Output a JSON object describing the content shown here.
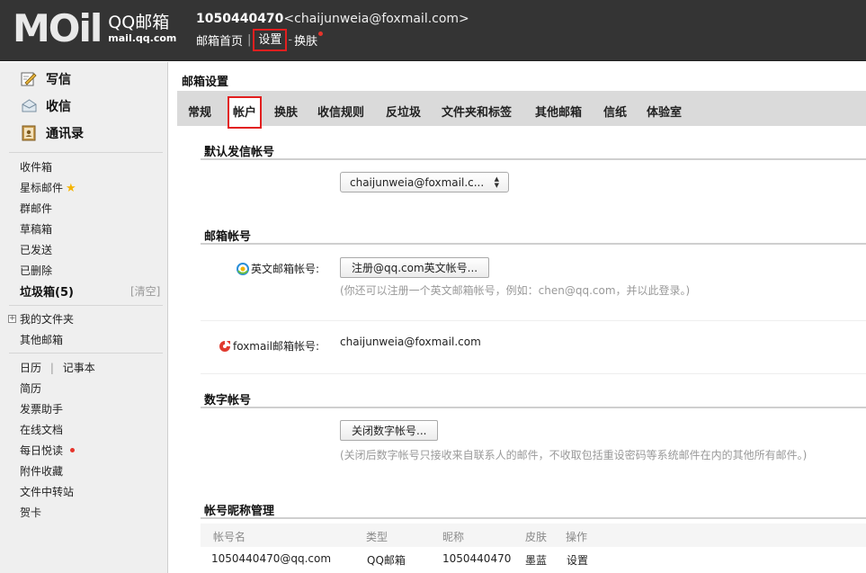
{
  "header": {
    "logo_text": "MOil",
    "brand": "QQ邮箱",
    "brand_url": "mail.qq.com",
    "user_id": "1050440470",
    "user_email": "<chaijunweia@foxmail.com>",
    "nav": {
      "home": "邮箱首页",
      "sep": "|",
      "settings": "设置",
      "dash": "-",
      "skin": "换肤"
    }
  },
  "sidebar": {
    "actions": {
      "compose": "写信",
      "receive": "收信",
      "contacts": "通讯录"
    },
    "folders": {
      "inbox": "收件箱",
      "starred": "星标邮件",
      "group": "群邮件",
      "drafts": "草稿箱",
      "sent": "已发送",
      "deleted": "已删除",
      "spam": "垃圾箱(5)",
      "spam_clear": "[清空]"
    },
    "my_folders": "我的文件夹",
    "other_mail": "其他邮箱",
    "tools": {
      "calendar": "日历",
      "tool_sep": "|",
      "notes": "记事本",
      "resume": "简历",
      "invoice": "发票助手",
      "docs": "在线文档",
      "daily": "每日悦读",
      "attachments": "附件收藏",
      "transfer": "文件中转站",
      "cards": "贺卡"
    }
  },
  "main": {
    "title": "邮箱设置",
    "tabs": [
      "常规",
      "帐户",
      "换肤",
      "收信规则",
      "反垃圾",
      "文件夹和标签",
      "其他邮箱",
      "信纸",
      "体验室"
    ],
    "default_sender": {
      "title": "默认发信帐号",
      "selected": "chaijunweia@foxmail.c..."
    },
    "mail_accounts": {
      "title": "邮箱帐号",
      "en_label": "英文邮箱帐号:",
      "en_button": "注册@qq.com英文帐号...",
      "en_hint": "(你还可以注册一个英文邮箱帐号，例如：chen@qq.com，并以此登录。)",
      "foxmail_label": "foxmail邮箱帐号:",
      "foxmail_value": "chaijunweia@foxmail.com"
    },
    "digit_account": {
      "title": "数字帐号",
      "button": "关闭数字帐号...",
      "hint": "(关闭后数字帐号只接收来自联系人的邮件，不收取包括重设密码等系统邮件在内的其他所有邮件。)"
    },
    "nickname": {
      "title": "帐号昵称管理",
      "columns": [
        "帐号名",
        "类型",
        "昵称",
        "皮肤",
        "操作"
      ],
      "row": {
        "account": "1050440470@qq.com",
        "type": "QQ邮箱",
        "nick": "1050440470",
        "skin": "墨蓝",
        "action": "设置"
      }
    }
  },
  "colors": {
    "header_bg": "#343434",
    "highlight_box": "#e21f1f",
    "sidebar_bg": "#efefef",
    "tab_bar": "#dadada"
  }
}
